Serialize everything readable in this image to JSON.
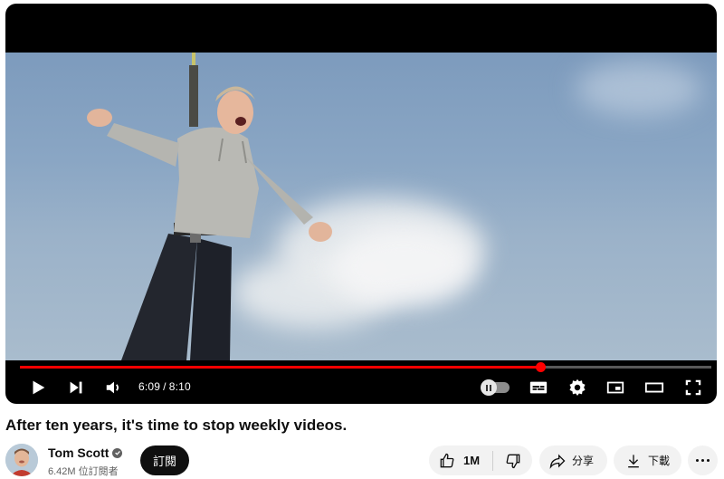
{
  "player": {
    "current_time": "6:09",
    "separator": "/",
    "duration": "8:10",
    "progress_fraction": 0.753,
    "accent_color": "#ff0000",
    "icons": [
      "play-icon",
      "next-icon",
      "volume-icon",
      "autoplay-toggle",
      "subtitles-icon",
      "settings-icon",
      "miniplayer-icon",
      "theater-icon",
      "fullscreen-icon"
    ]
  },
  "video": {
    "title": "After ten years, it's time to stop weekly videos."
  },
  "channel": {
    "name": "Tom Scott",
    "subscribers": "6.42M 位訂閱者",
    "subscribe_label": "訂閱"
  },
  "actions": {
    "like_count": "1M",
    "share_label": "分享",
    "download_label": "下載"
  }
}
